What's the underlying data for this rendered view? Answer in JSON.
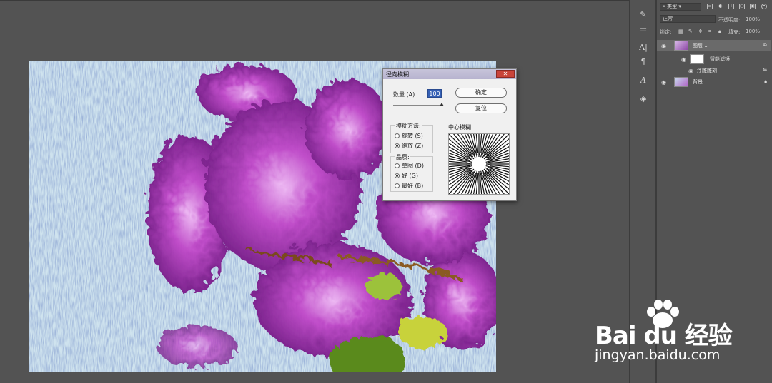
{
  "dialog": {
    "title": "径向模糊",
    "close_glyph": "✕",
    "amount_label": "数量 (A)",
    "amount_value": "100",
    "ok_label": "确定",
    "reset_label": "复位",
    "method_label": "模糊方法:",
    "method_options": [
      "旋转 (S)",
      "缩放 (Z)"
    ],
    "method_selected": "缩放 (Z)",
    "quality_label": "品质:",
    "quality_options": [
      "草图 (D)",
      "好 (G)",
      "最好 (B)"
    ],
    "quality_selected": "好 (G)",
    "center_label": "中心模糊"
  },
  "layers_panel": {
    "filter_kind": "类型",
    "blend_mode": "正常",
    "opacity_label": "不透明度:",
    "opacity_value": "100%",
    "lock_label": "锁定:",
    "fill_label": "填充:",
    "fill_value": "100%",
    "layers": [
      {
        "name": "图层 1",
        "selected": true
      },
      {
        "name": "智能滤镜",
        "selected": false
      },
      {
        "name": "浮雕雕刻",
        "selected": false
      },
      {
        "name": "背景",
        "selected": false
      }
    ]
  },
  "tools": [
    "brush-icon",
    "adjust-icon",
    "character-icon",
    "paragraph-icon",
    "glyph-icon",
    "3d-icon"
  ],
  "watermark": {
    "brand": "Bai  du 经验",
    "url": "jingyan.baidu.com"
  },
  "colors": {
    "workspace": "#535353",
    "accent_input": "#3560b5",
    "close_button": "#c9433a"
  }
}
